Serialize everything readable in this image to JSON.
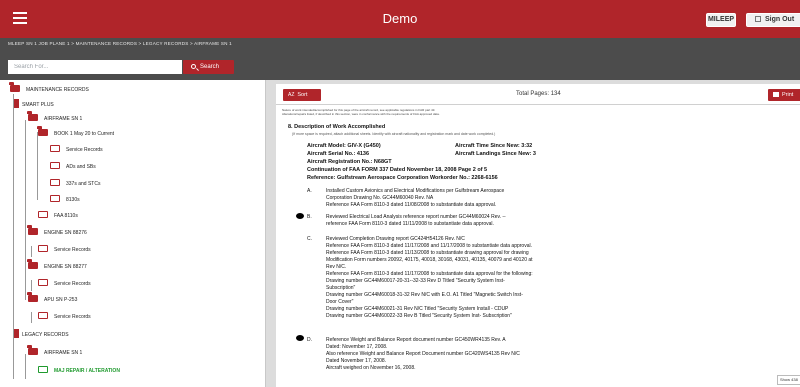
{
  "header": {
    "title": "Demo",
    "user_label": "MILEEP",
    "signout_label": "Sign Out"
  },
  "breadcrumb": "MLEEP SN 1 JOB PLANE 1 > MAINTENANCE RECORDS > LEGACY RECORDS > AIRFRAME SN 1",
  "search": {
    "placeholder": "Search For...",
    "button_label": "Search"
  },
  "tree": {
    "items": [
      {
        "label": "MAINTENANCE RECORDS"
      },
      {
        "label": "SMART PLUS"
      },
      {
        "label": "AIRFRAME SN 1"
      },
      {
        "label": "BOOK 1 May 20 to Current"
      },
      {
        "label": "Service Records"
      },
      {
        "label": "ADs and SBs"
      },
      {
        "label": "337s and STCs"
      },
      {
        "label": "8130s"
      },
      {
        "label": "FAA 8110s"
      },
      {
        "label": "ENGINE SN 88276"
      },
      {
        "label": "Service Records"
      },
      {
        "label": "ENGINE SN 88277"
      },
      {
        "label": "Service Records"
      },
      {
        "label": "APU SN P-253"
      },
      {
        "label": "Service Records"
      },
      {
        "label": "LEGACY RECORDS"
      },
      {
        "label": "AIRFRAME SN 1"
      },
      {
        "label": "MAJ REPAIR / ALTERATION"
      }
    ]
  },
  "viewer": {
    "sort_label": "Sort",
    "sort_icon_text": "AZ",
    "total_pages": "Total Pages: 134",
    "print_label": "Print"
  },
  "document": {
    "top_note_1": "Nature of work intended/accomplished for this page of the aircraft record, see applicable regulations in FAR part 43.",
    "top_note_2": "Alterations/repairs listed, if described in this section, were in conformance with the requirements of FAA approved data.",
    "section_title": "8. Description of Work Accomplished",
    "section_sub": "(If more space is required, attach additional sheets. Identify with aircraft nationality and registration mark and date work completed.)",
    "aircraft_model": "Aircraft Model:  GIV-X (G450)",
    "aircraft_time": "Aircraft Time Since New:   3:32",
    "aircraft_serial": "Aircraft Serial No.:  4136",
    "aircraft_landings": "Aircraft Landings Since New:  3",
    "aircraft_reg": "Aircraft Registration No.:  N68GT",
    "continuation": "Continuation of FAA FORM 337 Dated November 18, 2008    Page 2 of 5",
    "reference": "Reference:  Gulfstream Aerospace Corporation Workorder No.: 2268-6156",
    "items": [
      {
        "mark": "A.",
        "lines": [
          "Installed Custom Avionics and Electrical Modifications per Gulfstream Aerospace",
          "Corporation Drawing No. GC44M60040 Rev. NA",
          "Reference FAA Form 8110-3 dated 11/08/2008 to substantiate data approval."
        ]
      },
      {
        "mark": "B.",
        "lines": [
          "Reviewed Electrical Load Analysis reference report number GC44M60024 Rev. --",
          "reference FAA Form 8110-3 dated 11/11/2008 to substantiate data approval."
        ]
      },
      {
        "mark": "C.",
        "lines": [
          "Reviewed Completion Drawing report GC424H54126 Rev. N/C",
          "Reference FAA Form 8110-3 dated 11/17/2008 and 11/17/2008 to substantiate data approval.",
          "Reference FAA Form 8110-3 dated 11/13/2008 to substantiate drawing approval for drawing",
          "Modification Form numbers 20092, 40175, 40018, 30168, 43031, 40135, 40079 and 40120 at",
          "Rev N/C.",
          "Reference FAA Form 8110-3 dated 11/17/2008 to substantiate data approval for the following:",
          "Drawing number GC44M60017-20-31--32-33 Rev D Titled \"Security System Inst-",
          "Subscription\"",
          "Drawing number GC44M60018-31-32 Rev N/C with E.O. A1 Titled \"Magnetic Switch Inst-",
          "Door Cover\"",
          "Drawing number GC44M60021-31 Rev N/C Titled \"Security System Install - CDUP",
          "Drawing number GC44M60022-33 Rev B Titled \"Security System Inst- Subscription\""
        ]
      },
      {
        "mark": "D.",
        "lines": [
          "Reference Weight and Balance Report document number GC450WR4135 Rev. A",
          "Dated: November 17, 2008.",
          "Also reference Weight and Balance Report Document number GC420WS4135 Rev N/C",
          "Dated November 17, 2008.",
          "Aircraft weighed on November 16, 2008."
        ]
      }
    ]
  },
  "zoom_label": "Show 438"
}
